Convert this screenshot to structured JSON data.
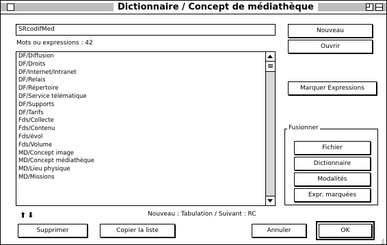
{
  "window": {
    "title": "Dictionnaire / Concept de médiathèque"
  },
  "name_field": {
    "value": "SRcodifMed"
  },
  "count_label": "Mots ou expressions : 42",
  "list": {
    "items": [
      "DF/Diffusion",
      "DF/Droits",
      "DF/Internet/Intranet",
      "DF/Relais",
      "DF/Répertoire",
      "DF/Service télématique",
      "DF/Supports",
      "DF/Tarifs",
      "Fds/Collecte",
      "Fds/Contenu",
      "Fds/évol",
      "Fds/Volume",
      "MD/Concept image",
      "MD/Concept médiathèque",
      "MD/Lieu physique",
      "MD/Missions"
    ]
  },
  "buttons": {
    "nouveau": "Nouveau",
    "ouvrir": "Ouvrir",
    "marquer": "Marquer Expressions",
    "supprimer": "Supprimer",
    "copier": "Copier la liste",
    "annuler": "Annuler",
    "ok": "OK"
  },
  "fusion_group": {
    "title": "Fusionner",
    "buttons": {
      "fichier": "Fichier",
      "dictionnaire": "Dictionnaire",
      "modalites": "Modalités",
      "expr": "Expr. marquées"
    }
  },
  "hint": "Nouveau : Tabulation / Suivant : RC",
  "arrows_glyph": "⬆ ⬇",
  "icons": {
    "close": "close-box-icon",
    "zoom": "zoom-box-icon",
    "collapse": "collapse-box-icon",
    "up": "arrow-up-icon",
    "down": "arrow-down-icon",
    "grow": "resize-grip-icon"
  },
  "colors": {
    "background": "#ffffff",
    "stroke": "#000000",
    "scroll_track": "#d8d8d8"
  }
}
